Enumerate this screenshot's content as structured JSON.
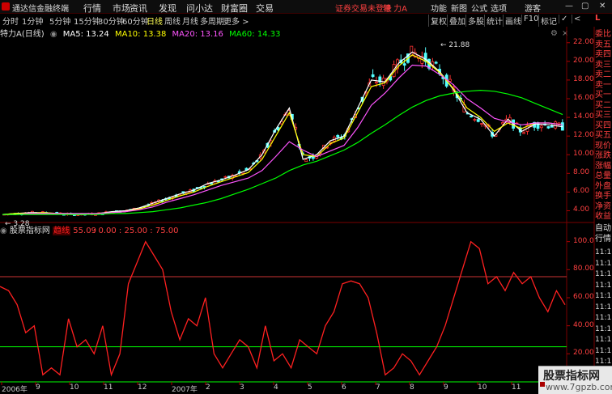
{
  "titlebar": {
    "app_title": "通达信金融终端",
    "menu": [
      "行情",
      "市场",
      "资讯",
      "发现",
      "问小达",
      "财富圈",
      "交易"
    ],
    "alert": "证券交易未登录",
    "stock": "特 力A",
    "right_menu": [
      "功能",
      "新图",
      "公式",
      "选项"
    ],
    "guest": "游客",
    "window_controls": [
      "—",
      "▢",
      "✕"
    ]
  },
  "periodbar": {
    "periods": [
      "分时",
      "1分钟",
      "5分钟",
      "15分钟",
      "30分钟",
      "60分钟",
      "日线",
      "周线",
      "月线",
      "多周期",
      "更多 >"
    ],
    "active": "日线",
    "tools": [
      "复权",
      "叠加",
      "多股",
      "统计",
      "画线",
      "F10",
      "标记",
      "✓",
      "<"
    ]
  },
  "chart_legend": {
    "name": "特力A",
    "period": "(日线)",
    "ma5": "MA5: 13.24",
    "ma10": "MA10: 13.38",
    "ma20": "MA20: 13.16",
    "ma60": "MA60: 14.33",
    "colors": {
      "ma5": "#ffffff",
      "ma10": "#ffff00",
      "ma20": "#ff55ff",
      "ma60": "#00ff00"
    }
  },
  "indicator_legend": {
    "name": "股票指标网",
    "line_label": "趋线",
    "value": "55.09",
    "ref_lines": ": 0.00 : 25.00 : 75.00"
  },
  "side_panel": {
    "items": [
      "委比",
      "卖五",
      "卖四",
      "卖三",
      "卖二",
      "卖一",
      "买一",
      "买二",
      "买三",
      "买四",
      "买五",
      "现价",
      "涨跌",
      "涨幅",
      "总量",
      "外盘",
      "换手",
      "净资",
      "收益"
    ],
    "lower": [
      "自动",
      "行情"
    ],
    "times": [
      "11:1",
      "11:1",
      "11:1",
      "11:1",
      "11:1",
      "11:1",
      "11:1",
      "11:1",
      "11:1",
      "11:1",
      "11:1"
    ]
  },
  "watermark": {
    "title": "股票指标网",
    "url": "www.7gpzb.com"
  },
  "chart_data": [
    {
      "type": "candlestick",
      "title": "特力A (日线)",
      "yaxis_ticks": [
        "22.00",
        "20.00",
        "18.00",
        "16.00",
        "14.00",
        "12.00",
        "10.00",
        "8.00",
        "6.00",
        "4.00"
      ],
      "ylim": [
        3,
        22.5
      ],
      "annotations": [
        {
          "label": "21.88",
          "value": 21.88
        },
        {
          "label": "3.28",
          "value": 3.28
        }
      ],
      "x_labels": [
        "2006年",
        "9",
        "10",
        "11",
        "12",
        "2007年",
        "2",
        "3",
        "4",
        "5",
        "6",
        "7",
        "8",
        "9",
        "10",
        "11"
      ],
      "series": [
        {
          "name": "MA5",
          "color": "#ffffff",
          "values": [
            3.6,
            3.7,
            3.8,
            3.8,
            3.7,
            3.6,
            3.6,
            3.7,
            3.9,
            4.0,
            4.3,
            4.8,
            5.3,
            5.8,
            6.2,
            6.9,
            7.3,
            7.8,
            8.4,
            10.0,
            12.7,
            15.0,
            9.5,
            10.0,
            11.5,
            12.0,
            15.0,
            18.0,
            17.8,
            19.8,
            21.0,
            20.2,
            18.9,
            17.0,
            14.5,
            13.8,
            12.0,
            13.8,
            12.5,
            13.3,
            13.2,
            13.0
          ]
        },
        {
          "name": "MA10",
          "color": "#ffff00",
          "values": [
            3.6,
            3.7,
            3.7,
            3.8,
            3.7,
            3.7,
            3.6,
            3.7,
            3.8,
            3.9,
            4.2,
            4.6,
            5.1,
            5.6,
            6.0,
            6.6,
            7.1,
            7.6,
            8.1,
            9.5,
            12.0,
            14.5,
            10.0,
            9.8,
            11.2,
            11.8,
            14.5,
            17.3,
            17.7,
            19.5,
            20.7,
            20.0,
            18.8,
            17.1,
            15.0,
            14.0,
            12.5,
            13.4,
            12.8,
            13.4,
            13.4,
            13.2
          ]
        },
        {
          "name": "MA20",
          "color": "#ff55ff",
          "values": [
            3.6,
            3.6,
            3.7,
            3.7,
            3.7,
            3.7,
            3.7,
            3.7,
            3.8,
            3.9,
            4.1,
            4.4,
            4.9,
            5.3,
            5.7,
            6.2,
            6.7,
            7.1,
            7.5,
            8.3,
            9.8,
            11.4,
            10.5,
            9.8,
            10.4,
            11.0,
            12.9,
            15.3,
            16.6,
            18.2,
            19.6,
            19.5,
            18.6,
            17.5,
            16.0,
            15.0,
            13.9,
            13.5,
            13.2,
            13.4,
            13.4,
            13.2
          ]
        },
        {
          "name": "MA60",
          "color": "#00ff00",
          "values": [
            3.6,
            3.6,
            3.6,
            3.6,
            3.6,
            3.6,
            3.6,
            3.6,
            3.7,
            3.7,
            3.8,
            3.9,
            4.1,
            4.3,
            4.6,
            4.9,
            5.3,
            5.8,
            6.3,
            6.9,
            7.5,
            8.3,
            8.9,
            9.3,
            9.9,
            10.5,
            11.3,
            12.3,
            13.2,
            14.2,
            15.1,
            15.8,
            16.3,
            16.6,
            16.8,
            16.9,
            16.8,
            16.5,
            16.1,
            15.5,
            14.9,
            14.3
          ]
        }
      ]
    },
    {
      "type": "line",
      "title": "股票指标网",
      "yaxis_ticks": [
        "100.0",
        "80.00",
        "60.00",
        "40.00",
        "20.00"
      ],
      "ylim": [
        0,
        105
      ],
      "reference_lines": [
        {
          "value": 75,
          "color": "#cc3333"
        },
        {
          "value": 25,
          "color": "#00ff00"
        },
        {
          "value": 0,
          "color": "#00ff00"
        }
      ],
      "series": [
        {
          "name": "趋线",
          "color": "#ff2020",
          "values": [
            68,
            65,
            55,
            35,
            40,
            5,
            10,
            5,
            45,
            25,
            30,
            20,
            40,
            5,
            20,
            70,
            85,
            100,
            90,
            80,
            50,
            30,
            45,
            40,
            60,
            20,
            10,
            20,
            30,
            25,
            10,
            40,
            15,
            20,
            10,
            30,
            25,
            20,
            40,
            50,
            70,
            72,
            70,
            60,
            35,
            5,
            10,
            20,
            15,
            5,
            15,
            25,
            40,
            60,
            80,
            100,
            95,
            70,
            75,
            65,
            78,
            70,
            75,
            60,
            50,
            65,
            55
          ]
        }
      ]
    }
  ]
}
